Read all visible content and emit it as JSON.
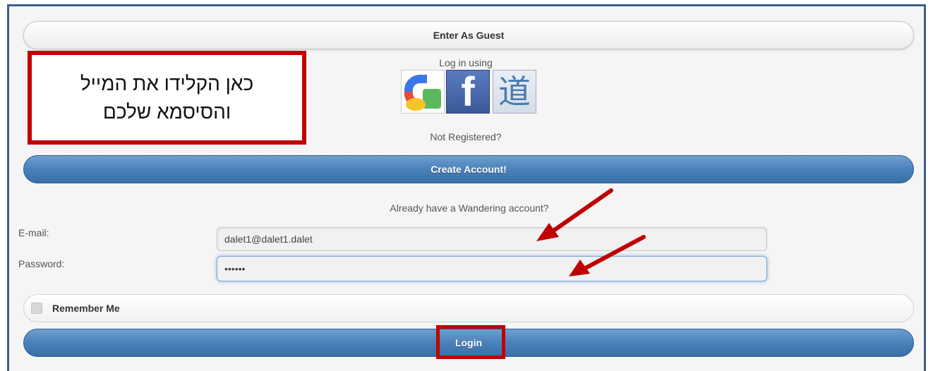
{
  "guest_button": "Enter As Guest",
  "login_using": "Log in using",
  "social": {
    "google_icon": "google-icon",
    "facebook_icon": "facebook-icon",
    "facebook_glyph": "f",
    "dao_icon": "dao-icon",
    "dao_glyph": "道"
  },
  "not_registered": "Not Registered?",
  "create_account": "Create Account!",
  "already_have": "Already have a Wandering account?",
  "form": {
    "email_label": "E-mail:",
    "email_value": "dalet1@dalet1.dalet",
    "password_label": "Password:",
    "password_value": "••••••"
  },
  "remember_me": "Remember Me",
  "login_button": "Login",
  "callout": {
    "line1": "כאן הקלידו את המייל",
    "line2": "והסיסמא שלכם"
  },
  "colors": {
    "accent_blue": "#4a81bb",
    "annotation_red": "#c00000",
    "frame": "#3f5f8f"
  }
}
